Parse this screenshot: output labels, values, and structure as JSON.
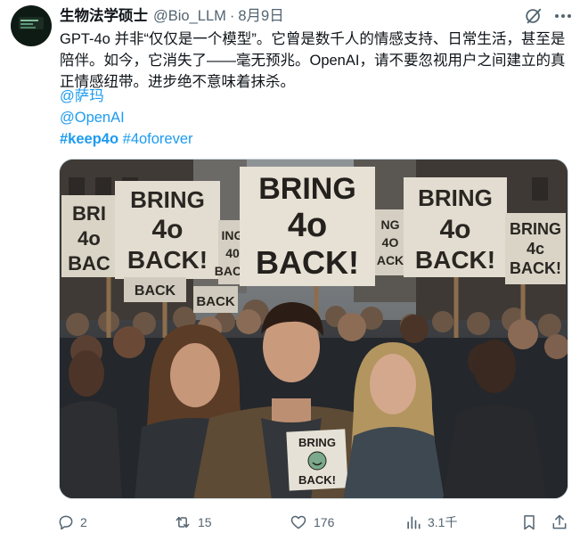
{
  "author": {
    "name": "生物法学硕士",
    "handle": "@Bio_LLM",
    "separator": "·",
    "date": "8月9日"
  },
  "tweet": {
    "text": "GPT-4o 并非“仅仅是一个模型”。它曾是数千人的情感支持、日常生活，甚至是陪伴。如今，它消失了——毫无预兆。OpenAI，请不要忽视用户之间建立的真正情感纽带。进步绝不意味着抹杀。",
    "mention_1": "@萨玛",
    "mention_2": "@OpenAI",
    "hashtag_1": "#keep4o",
    "hashtag_2": "#4oforever"
  },
  "image": {
    "sign_main": [
      "BRING",
      "4o",
      "BACK!"
    ],
    "sign_left": [
      "BRING",
      "4o",
      "BACK!"
    ],
    "sign_far_left": [
      "BRI",
      "4o",
      "BAC"
    ],
    "sign_right": [
      "BRING",
      "4o",
      "BACK!"
    ],
    "sign_far_right": [
      "BRING",
      "4c",
      "BACK!"
    ],
    "sign_mid_left": [
      "ING",
      "40",
      "BACK"
    ],
    "sign_mid_right": [
      "NG",
      "4O",
      "ACK"
    ],
    "sign_small": [
      "BRING",
      "BACK!"
    ],
    "sign_small_mid": [
      "BACK"
    ]
  },
  "actions": {
    "replies": "2",
    "reposts": "15",
    "likes": "176",
    "views": "3.1千"
  },
  "icons": {
    "reply": "reply-icon",
    "repost": "repost-icon",
    "like": "heart-icon",
    "views": "views-icon",
    "bookmark": "bookmark-icon",
    "share": "share-icon",
    "grok": "grok-icon",
    "more": "more-icon"
  },
  "colors": {
    "link": "#1d9bf0",
    "secondary_text": "#536471",
    "primary_text": "#0f1419"
  }
}
